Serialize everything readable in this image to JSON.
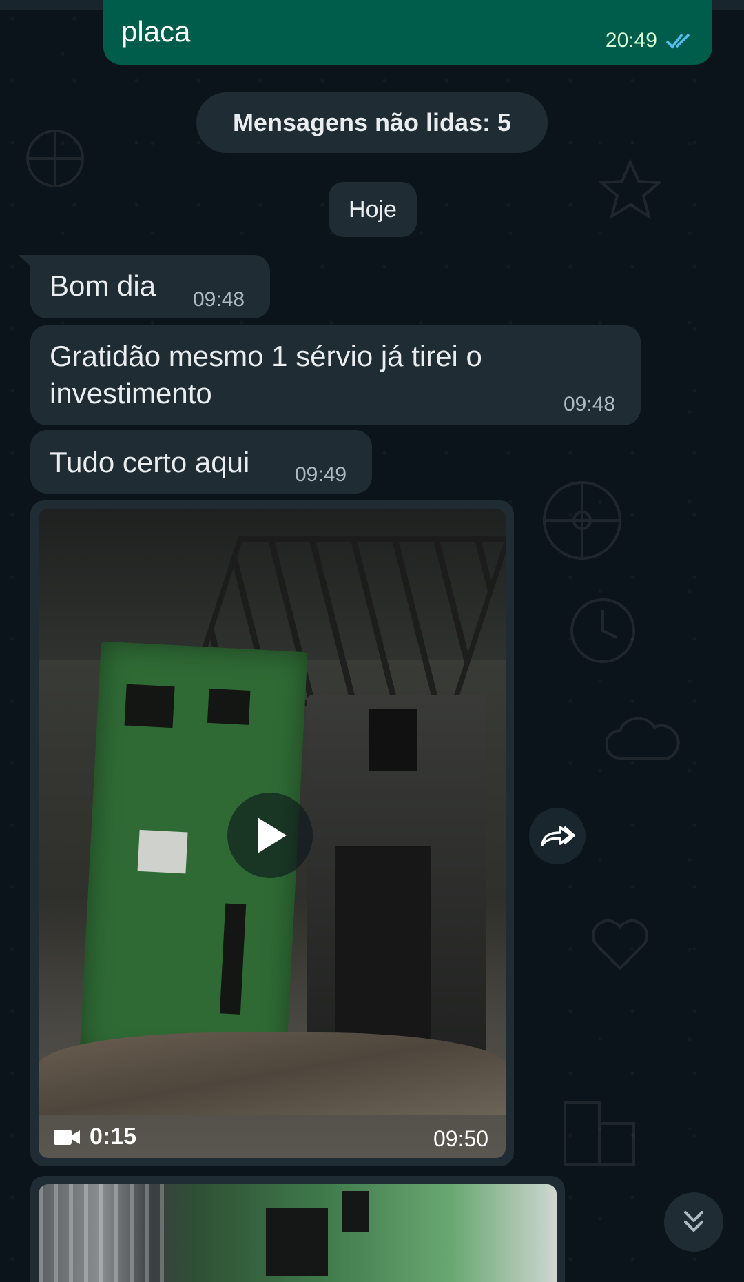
{
  "outgoing": {
    "text": "placa",
    "time": "20:49"
  },
  "unread_banner": "Mensagens não lidas: 5",
  "date_chip": "Hoje",
  "messages": [
    {
      "text": "Bom dia",
      "time": "09:48"
    },
    {
      "line1": "Gratidão mesmo 1 sérvio já tirei o",
      "line2": "investimento",
      "time": "09:48"
    },
    {
      "text": "Tudo certo aqui",
      "time": "09:49"
    }
  ],
  "video": {
    "duration": "0:15",
    "time": "09:50"
  },
  "colors": {
    "background": "#0b141a",
    "incoming_bubble": "#1f2c34",
    "outgoing_bubble": "#005c4b",
    "read_ticks": "#53bdeb"
  },
  "icons": [
    "double-check-icon",
    "play-icon",
    "video-camera-icon",
    "forward-icon",
    "double-chevron-down-icon"
  ]
}
